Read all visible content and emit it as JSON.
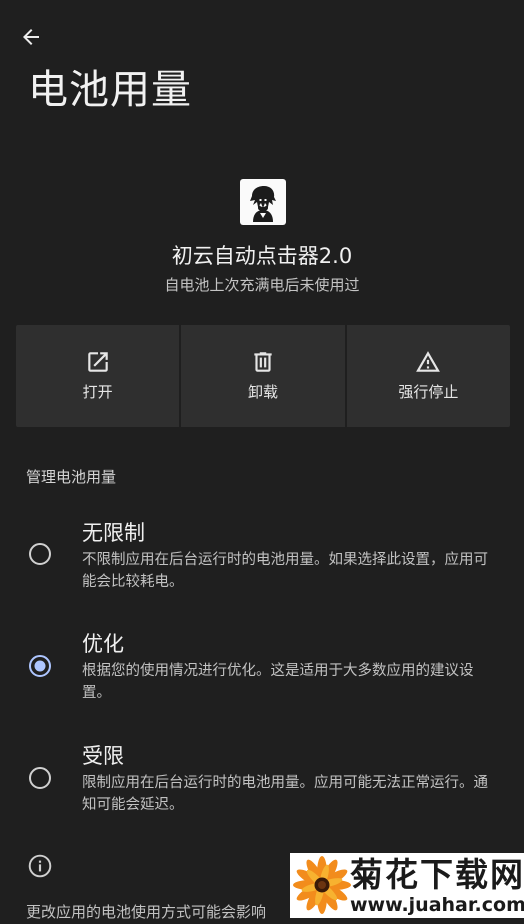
{
  "header": {
    "back_icon": "arrow-left-icon",
    "title": "电池用量"
  },
  "app": {
    "name": "初云自动点击器2.0",
    "subtitle": "自电池上次充满电后未使用过",
    "icon": "app-avatar-icon"
  },
  "actions": [
    {
      "label": "打开",
      "icon": "open-external-icon"
    },
    {
      "label": "卸载",
      "icon": "trash-icon"
    },
    {
      "label": "强行停止",
      "icon": "warning-triangle-icon"
    }
  ],
  "battery_section": {
    "header": "管理电池用量",
    "options": [
      {
        "title": "无限制",
        "description": "不限制应用在后台运行时的电池用量。如果选择此设置，应用可能会比较耗电。",
        "selected": false
      },
      {
        "title": "优化",
        "description": "根据您的使用情况进行优化。这是适用于大多数应用的建议设置。",
        "selected": true
      },
      {
        "title": "受限",
        "description": "限制应用在后台运行时的电池用量。应用可能无法正常运行。通知可能会延迟。",
        "selected": false
      }
    ]
  },
  "footer": {
    "info_icon": "info-icon",
    "text": "更改应用的电池使用方式可能会影响"
  },
  "watermark": {
    "text": "菊花下载网",
    "url": "www.juahar.com"
  },
  "colors": {
    "background": "#1f1f1f",
    "card": "#2f2f2f",
    "accent": "#aec6ff",
    "text_primary": "#f0f0f0",
    "text_secondary": "#c2c2c2"
  }
}
